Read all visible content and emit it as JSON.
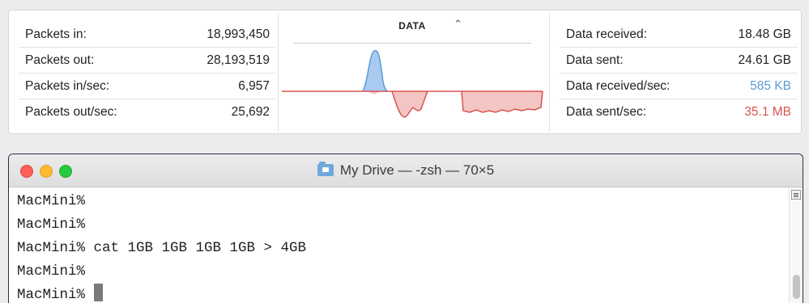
{
  "activity": {
    "left_stats": [
      {
        "label": "Packets in:",
        "value": "18,993,450"
      },
      {
        "label": "Packets out:",
        "value": "28,193,519"
      },
      {
        "label": "Packets in/sec:",
        "value": "6,957"
      },
      {
        "label": "Packets out/sec:",
        "value": "25,692"
      }
    ],
    "graph": {
      "selector_label": "DATA",
      "selector_icon": "chevron-updown-icon",
      "colors": {
        "received": "#5b9bd5",
        "received_fill": "#a9cbf0",
        "sent": "#d9534f",
        "sent_fill": "#f4c6c3"
      }
    },
    "right_stats": [
      {
        "label": "Data received:",
        "value": "18.48 GB",
        "color": "#222222"
      },
      {
        "label": "Data sent:",
        "value": "24.61 GB",
        "color": "#222222"
      },
      {
        "label": "Data received/sec:",
        "value": "585 KB",
        "color": "#5b9bd5"
      },
      {
        "label": "Data sent/sec:",
        "value": "35.1 MB",
        "color": "#d9534f"
      }
    ]
  },
  "terminal": {
    "title": "My Drive — -zsh — 70×5",
    "title_icon": "folder-icon",
    "lines": [
      "MacMini%",
      "MacMini%",
      "MacMini% cat 1GB 1GB 1GB 1GB > 4GB",
      "MacMini%",
      "MacMini% "
    ]
  }
}
